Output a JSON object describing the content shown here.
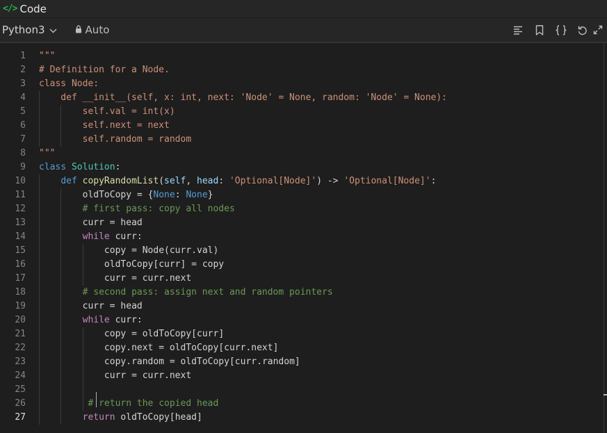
{
  "header": {
    "title": "Code",
    "code_icon": "</>"
  },
  "toolbar": {
    "language": "Python3",
    "mode": "Auto",
    "tools": [
      "format-icon",
      "bookmark-icon",
      "braces-icon",
      "reset-icon",
      "expand-icon"
    ]
  },
  "colors": {
    "comment": "#6a9955",
    "string": "#ce9178",
    "keyword": "#c586c0",
    "def": "#569cd6",
    "func": "#dcdcaa",
    "param": "#9cdcfe",
    "builtin": "#4ec9b0",
    "plain": "#d4d4d4"
  },
  "editor": {
    "active_line": 27,
    "lines": [
      {
        "n": "1",
        "t": "\"\"\""
      },
      {
        "n": "2",
        "t": "# Definition for a Node."
      },
      {
        "n": "3",
        "t": "class Node:"
      },
      {
        "n": "4",
        "t": "    def __init__(self, x: int, next: 'Node' = None, random: 'Node' = None):"
      },
      {
        "n": "5",
        "t": "        self.val = int(x)"
      },
      {
        "n": "6",
        "t": "        self.next = next"
      },
      {
        "n": "7",
        "t": "        self.random = random"
      },
      {
        "n": "8",
        "t": "\"\"\""
      },
      {
        "n": "9",
        "t": "class Solution:"
      },
      {
        "n": "10",
        "t": "    def copyRandomList(self, head: 'Optional[Node]') -> 'Optional[Node]':"
      },
      {
        "n": "11",
        "t": "        oldToCopy = {None: None}"
      },
      {
        "n": "12",
        "t": "        # first pass: copy all nodes"
      },
      {
        "n": "13",
        "t": "        curr = head"
      },
      {
        "n": "14",
        "t": "        while curr:"
      },
      {
        "n": "15",
        "t": "            copy = Node(curr.val)"
      },
      {
        "n": "16",
        "t": "            oldToCopy[curr] = copy"
      },
      {
        "n": "17",
        "t": "            curr = curr.next"
      },
      {
        "n": "18",
        "t": "        # second pass: assign next and random pointers"
      },
      {
        "n": "19",
        "t": "        curr = head"
      },
      {
        "n": "20",
        "t": "        while curr:"
      },
      {
        "n": "21",
        "t": "            copy = oldToCopy[curr]"
      },
      {
        "n": "22",
        "t": "            copy.next = oldToCopy[curr.next]"
      },
      {
        "n": "23",
        "t": "            copy.random = oldToCopy[curr.random]"
      },
      {
        "n": "24",
        "t": "            curr = curr.next"
      },
      {
        "n": "25",
        "t": ""
      },
      {
        "n": "26",
        "t": "         # return the copied head"
      },
      {
        "n": "27",
        "t": "        return oldToCopy[head]"
      }
    ]
  }
}
